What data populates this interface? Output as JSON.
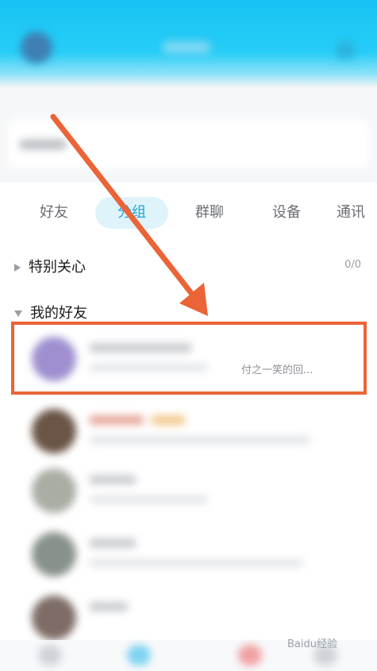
{
  "tabs": [
    "好友",
    "分组",
    "群聊",
    "设备",
    "通讯"
  ],
  "sections": {
    "special": "特别关心",
    "special_count": "0/0",
    "friends": "我的好友"
  },
  "contacts": {
    "first_status": "付之一笑的回..."
  },
  "watermark": "Baidu经验",
  "colors": {
    "header": "#17c3f3",
    "active_tab_bg": "#dff3fb",
    "active_tab_text": "#22a5d8",
    "annotation": "#ea6437"
  }
}
